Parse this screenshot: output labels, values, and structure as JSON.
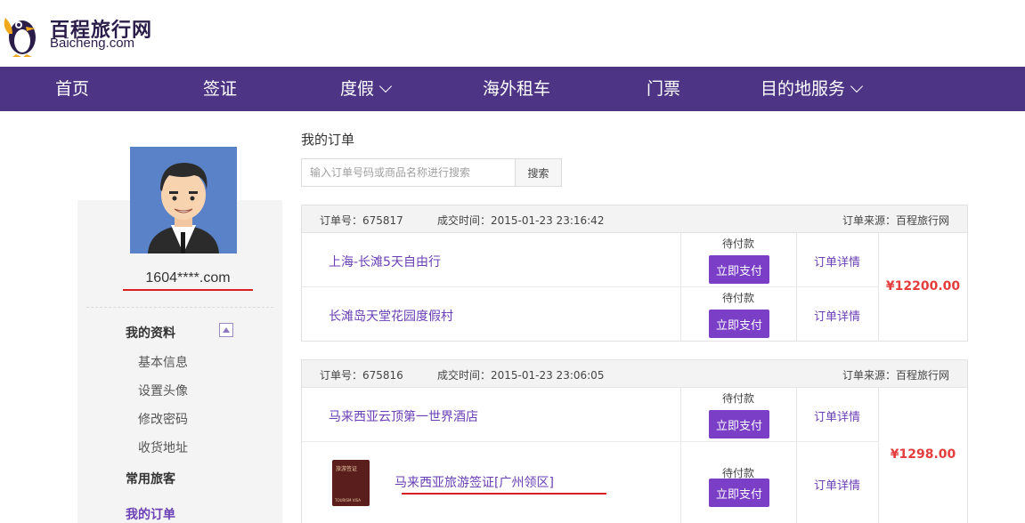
{
  "brand": {
    "name_cn": "百程旅行网",
    "name_en": "Baicheng.com"
  },
  "nav": {
    "items": [
      {
        "label": "首页"
      },
      {
        "label": "签证"
      },
      {
        "label": "度假"
      },
      {
        "label": "海外租车"
      },
      {
        "label": "门票"
      },
      {
        "label": "目的地服务"
      }
    ]
  },
  "user": {
    "username": "1604****.com"
  },
  "sidebar": {
    "profile_title": "我的资料",
    "profile_items": [
      "基本信息",
      "设置头像",
      "修改密码",
      "收货地址"
    ],
    "travelers_title": "常用旅客",
    "orders_title": "我的订单"
  },
  "main": {
    "title": "我的订单",
    "search_placeholder": "输入订单号码或商品名称进行搜索",
    "search_button": "搜索"
  },
  "orders": [
    {
      "order_no": "订单号：675817",
      "time": "成交时间：2015-01-23 23:16:42",
      "source": "订单来源：百程旅行网",
      "price": "¥12200.00",
      "items": [
        {
          "name": "上海-长滩5天自由行",
          "status": "待付款",
          "pay": "立即支付",
          "detail": "订单详情"
        },
        {
          "name": "长滩岛天堂花园度假村",
          "status": "待付款",
          "pay": "立即支付",
          "detail": "订单详情"
        }
      ]
    },
    {
      "order_no": "订单号：675816",
      "time": "成交时间：2015-01-23 23:06:05",
      "source": "订单来源：百程旅行网",
      "price": "¥1298.00",
      "items": [
        {
          "name": "马来西亚云顶第一世界酒店",
          "status": "待付款",
          "pay": "立即支付",
          "detail": "订单详情"
        },
        {
          "name": "马来西亚旅游签证[广州领区]",
          "status": "待付款",
          "pay": "立即支付",
          "detail": "订单详情"
        }
      ],
      "thumb_text": "旅游签证",
      "thumb_sub": "TOURISM VISA"
    }
  ],
  "colors": {
    "nav_bg": "#4e3485",
    "accent": "#7a3fc6",
    "price": "#e43d3d",
    "link": "#6a3fb5"
  }
}
